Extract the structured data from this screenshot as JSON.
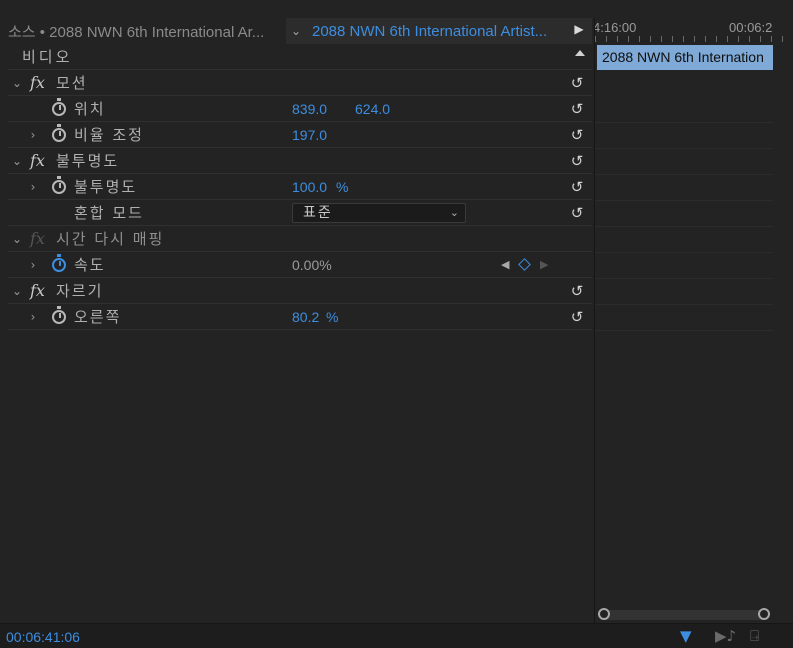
{
  "header": {
    "source_tab": "소스 • 2088 NWN 6th International Ar...",
    "clip_tab": "2088 NWN 6th International Artist...",
    "clip_chevron": "⌄",
    "play_icon": "▶"
  },
  "section": {
    "label": "비디오"
  },
  "effects": {
    "motion": {
      "name": "모션",
      "position_label": "위치",
      "position_x": "839.0",
      "position_y": "624.0",
      "scale_label": "비율 조정",
      "scale_value": "197.0"
    },
    "opacity": {
      "name": "불투명도",
      "opacity_label": "불투명도",
      "opacity_value": "100.0",
      "opacity_unit": "%",
      "blend_label": "혼합 모드",
      "blend_value": "표준"
    },
    "time_remap": {
      "name": "시간 다시 매핑",
      "speed_label": "속도",
      "speed_value": "0.00%"
    },
    "crop": {
      "name": "자르기",
      "right_label": "오른쪽",
      "right_value": "80.2",
      "right_unit": "%"
    }
  },
  "timeline": {
    "ruler_start": "4:16:00",
    "ruler_end": "00:06:2",
    "clip_label": "2088 NWN 6th Internation"
  },
  "footer": {
    "timecode": "00:06:41:06"
  },
  "colors": {
    "accent": "#3d8ee0",
    "clip_bar": "#7fa9d6",
    "panel_bg": "#232323"
  }
}
